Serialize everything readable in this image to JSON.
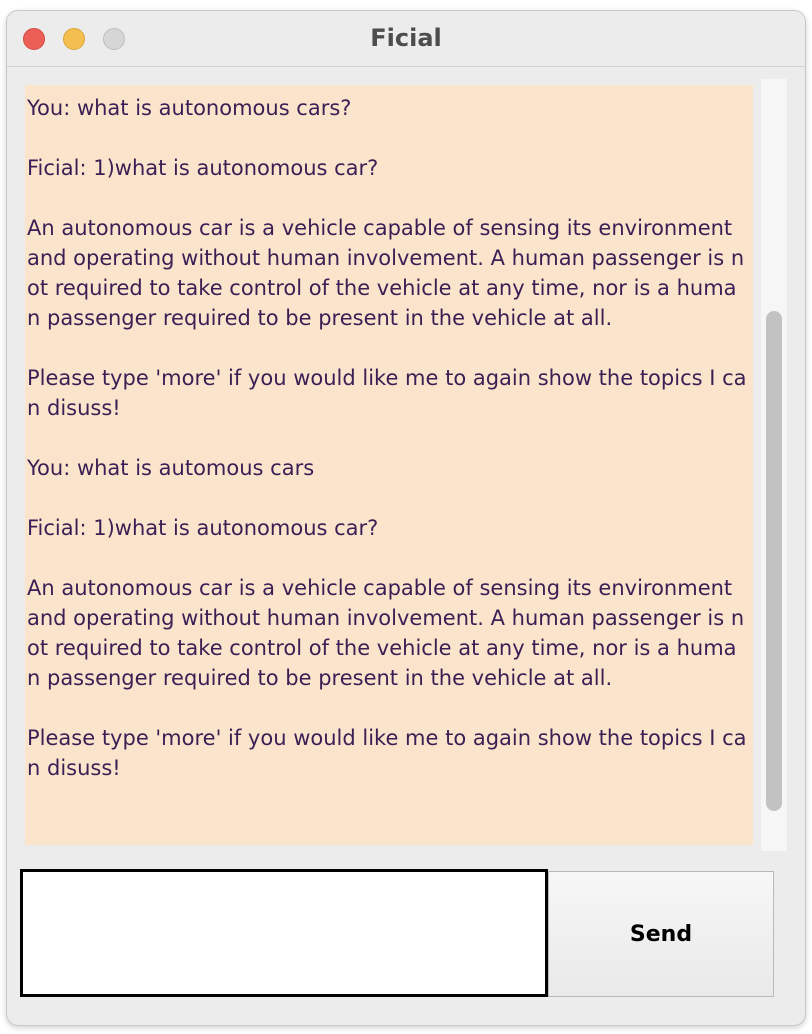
{
  "window": {
    "title": "Ficial"
  },
  "chat": {
    "transcript": "You: what is autonomous cars?\n\nFicial: 1)what is autonomous car?\n\nAn autonomous car is a vehicle capable of sensing its environment and operating without human involvement. A human passenger is not required to take control of the vehicle at any time, nor is a human passenger required to be present in the vehicle at all.\n\nPlease type 'more' if you would like me to again show the topics I can disuss!\n\nYou: what is automous cars\n\nFicial: 1)what is autonomous car?\n\nAn autonomous car is a vehicle capable of sensing its environment and operating without human involvement. A human passenger is not required to take control of the vehicle at any time, nor is a human passenger required to be present in the vehicle at all.\n\nPlease type 'more' if you would like me to again show the topics I can disuss!"
  },
  "input": {
    "value": ""
  },
  "send_button": {
    "label": "Send"
  },
  "colors": {
    "chat_background": "#fbe4cc",
    "chat_text": "#3a1f55",
    "close": "#ec5f57",
    "minimize": "#f4bf4f",
    "maximize": "#d6d6d6"
  }
}
